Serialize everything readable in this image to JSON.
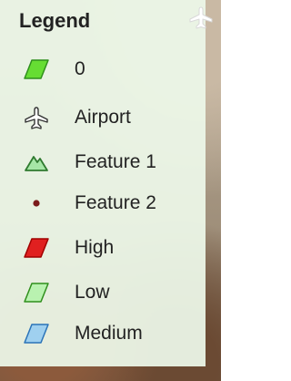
{
  "legend": {
    "title": "Legend",
    "items": [
      {
        "label": "0",
        "icon": "green-polygon-icon",
        "color": "#66dd33"
      },
      {
        "label": "Airport",
        "icon": "airport-icon",
        "color": "#333333"
      },
      {
        "label": "Feature 1",
        "icon": "mountain-icon",
        "color": "#2f7a2f"
      },
      {
        "label": "Feature 2",
        "icon": "dot-icon",
        "color": "#7a1b1b"
      },
      {
        "label": "High",
        "icon": "red-polygon-icon",
        "color": "#e02020"
      },
      {
        "label": "Low",
        "icon": "light-green-polygon-icon",
        "color": "#b9f2b0"
      },
      {
        "label": "Medium",
        "icon": "light-blue-polygon-icon",
        "color": "#9fd0ef"
      }
    ]
  },
  "map": {
    "corner_icon": "airport-icon"
  }
}
